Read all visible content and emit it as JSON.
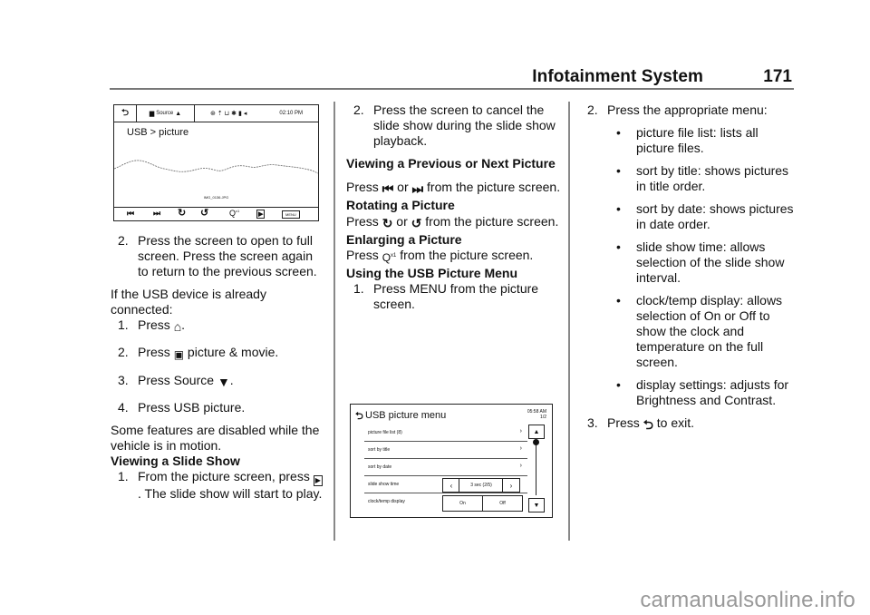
{
  "header": {
    "section_title": "Infotainment System",
    "page_number": "171"
  },
  "figure1": {
    "back_icon": "back-arrow-icon",
    "source_label": "Source",
    "status_icons": [
      "nav-icon",
      "signal-icon",
      "usb-icon",
      "bluetooth-icon",
      "battery-icon",
      "volume-icon"
    ],
    "time": "02:10 PM",
    "title": "USB > picture",
    "filename": "IMG_0136.JPG",
    "controls": [
      {
        "name": "previous-icon",
        "glyph": "⏮"
      },
      {
        "name": "next-icon",
        "glyph": "⏭"
      },
      {
        "name": "rotate-left-icon",
        "glyph": "↻"
      },
      {
        "name": "rotate-right-icon",
        "glyph": "↺"
      },
      {
        "name": "zoom-icon",
        "glyph": "Q"
      },
      {
        "name": "slideshow-icon",
        "glyph": "▶"
      }
    ],
    "zoom_suffix": "x1",
    "menu_label": "MENU"
  },
  "col1": {
    "step2": {
      "num": "2.",
      "text": "Press the screen to open to full screen. Press the screen again to return to the previous screen."
    },
    "connected_intro": "If the USB device is already connected:",
    "steps": [
      {
        "num": "1.",
        "pre": "Press",
        "icon": "home-icon",
        "post": "."
      },
      {
        "num": "2.",
        "pre": "Press",
        "icon": "picture-movie-icon",
        "post": " picture & movie."
      },
      {
        "num": "3.",
        "pre": "Press Source",
        "icon": "down-triangle-icon",
        "post": "."
      },
      {
        "num": "4.",
        "pre": "Press USB picture.",
        "icon": "",
        "post": ""
      }
    ],
    "disabled_note": "Some features are disabled while the vehicle is in motion.",
    "slideshow_heading": "Viewing a Slide Show",
    "slideshow_step1": {
      "num": "1.",
      "pre": "From the picture screen, press",
      "icon": "slideshow-icon",
      "post": ". The slide show will start to play."
    }
  },
  "col2": {
    "step2": {
      "num": "2.",
      "text": "Press the screen to cancel the slide show during the slide show playback."
    },
    "prev_next_heading": "Viewing a Previous or Next Picture",
    "prev_next_text": {
      "pre": "Press",
      "mid": " or ",
      "post": " from the picture screen."
    },
    "rotate_heading": "Rotating a Picture",
    "rotate_text": {
      "pre": "Press",
      "mid": " or ",
      "post": " from the picture screen."
    },
    "enlarge_heading": "Enlarging a Picture",
    "enlarge_text": {
      "pre": "Press",
      "post": " from the picture screen."
    },
    "menu_heading": "Using the USB Picture Menu",
    "menu_step1": {
      "num": "1.",
      "text": "Press MENU from the picture screen."
    }
  },
  "figure2": {
    "title": "USB picture menu",
    "time": "05:58 AM",
    "page": "1/2",
    "rows": [
      {
        "label": "picture file list (8)",
        "has_chevron": true
      },
      {
        "label": "sort by title",
        "has_chevron": true
      },
      {
        "label": "sort by date",
        "has_chevron": true
      },
      {
        "label": "slide show time",
        "has_chevron": false
      },
      {
        "label": "clock/temp display",
        "has_chevron": false
      }
    ],
    "slide_time_value": "3 sec (2/5)",
    "on_label": "On",
    "off_label": "Off",
    "scroll_position": 0.0
  },
  "col3": {
    "step2": {
      "num": "2.",
      "text": "Press the appropriate menu:"
    },
    "bullets": [
      "picture file list: lists all picture files.",
      "sort by title: shows pictures in title order.",
      "sort by date: shows pictures in date order.",
      "slide show time: allows selection of the slide show interval.",
      "clock/temp display: allows selection of On or Off to show the clock and temperature on the full screen.",
      "display settings: adjusts for Brightness and Contrast."
    ],
    "step3": {
      "num": "3.",
      "pre": "Press",
      "post": " to exit."
    }
  },
  "watermark": "carmanualsonline.info"
}
